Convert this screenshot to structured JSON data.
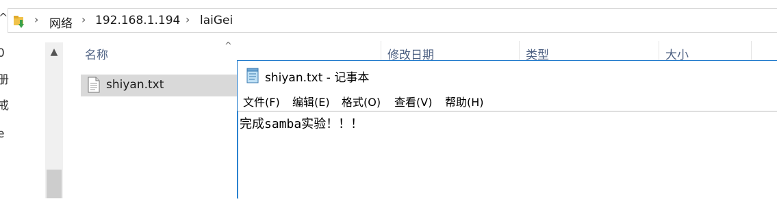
{
  "explorer": {
    "breadcrumb": [
      "网络",
      "192.168.1.194",
      "laiGei"
    ],
    "left_pane_fragments": [
      "0",
      "册",
      "戒",
      "e"
    ],
    "columns": [
      "名称",
      "修改日期",
      "类型",
      "大小"
    ],
    "files": [
      {
        "name": "shiyan.txt",
        "icon": "text-file-icon"
      }
    ]
  },
  "notepad": {
    "title": "shiyan.txt - 记事本",
    "menu": [
      "文件(F)",
      "编辑(E)",
      "格式(O)",
      "查看(V)",
      "帮助(H)"
    ],
    "content": "完成samba实验！！！"
  },
  "colors": {
    "header_text": "#4d6082",
    "selection": "#d9d9d9",
    "window_border": "#1f7acc",
    "scroll_thumb": "#cdcdcd"
  }
}
